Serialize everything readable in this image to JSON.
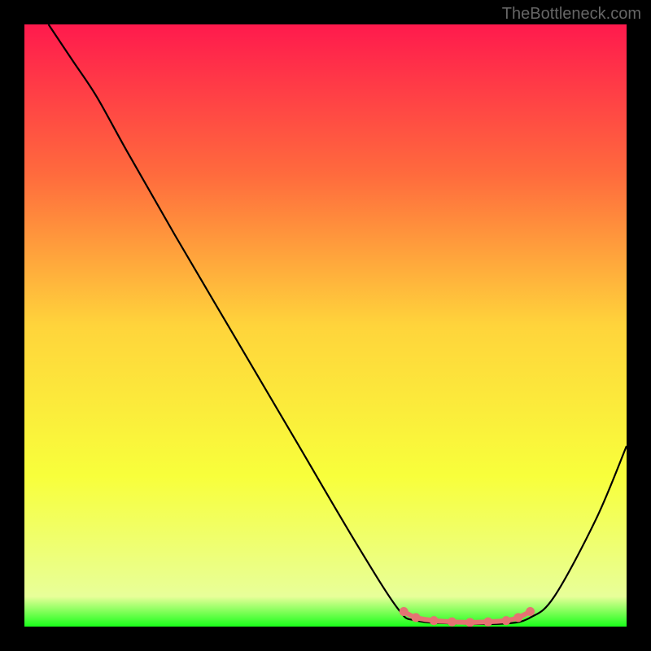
{
  "watermark": "TheBottleneck.com",
  "chart_data": {
    "type": "line",
    "title": "",
    "xlabel": "",
    "ylabel": "",
    "xlim": [
      0,
      100
    ],
    "ylim": [
      0,
      100
    ],
    "gradient_stops": [
      {
        "offset": 0,
        "color": "#ff1a4d"
      },
      {
        "offset": 25,
        "color": "#ff6b3d"
      },
      {
        "offset": 50,
        "color": "#ffd43b"
      },
      {
        "offset": 75,
        "color": "#f8ff3b"
      },
      {
        "offset": 95,
        "color": "#e8ff99"
      },
      {
        "offset": 100,
        "color": "#1aff1a"
      }
    ],
    "series": [
      {
        "name": "curve",
        "color": "#000000",
        "points": [
          {
            "x": 4,
            "y": 100
          },
          {
            "x": 8,
            "y": 94
          },
          {
            "x": 12,
            "y": 88
          },
          {
            "x": 17,
            "y": 79
          },
          {
            "x": 25,
            "y": 65
          },
          {
            "x": 35,
            "y": 48
          },
          {
            "x": 45,
            "y": 31
          },
          {
            "x": 55,
            "y": 14
          },
          {
            "x": 62,
            "y": 3
          },
          {
            "x": 65,
            "y": 1
          },
          {
            "x": 72,
            "y": 0.5
          },
          {
            "x": 80,
            "y": 0.5
          },
          {
            "x": 84,
            "y": 1.5
          },
          {
            "x": 88,
            "y": 5
          },
          {
            "x": 95,
            "y": 18
          },
          {
            "x": 100,
            "y": 30
          }
        ]
      }
    ],
    "highlight": {
      "color": "#e57373",
      "points": [
        {
          "x": 63,
          "y": 2.5
        },
        {
          "x": 65,
          "y": 1.5
        },
        {
          "x": 68,
          "y": 1
        },
        {
          "x": 71,
          "y": 0.8
        },
        {
          "x": 74,
          "y": 0.7
        },
        {
          "x": 77,
          "y": 0.8
        },
        {
          "x": 80,
          "y": 1
        },
        {
          "x": 82,
          "y": 1.5
        },
        {
          "x": 84,
          "y": 2.5
        }
      ]
    }
  }
}
